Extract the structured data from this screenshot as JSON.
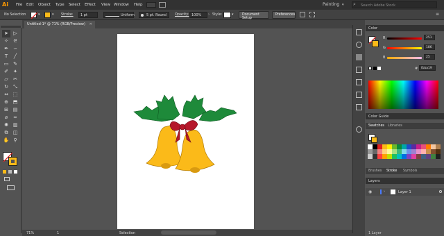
{
  "app": {
    "logo": "Ai",
    "workspace": "Painting",
    "search_placeholder": "Search Adobe Stock"
  },
  "menu": [
    "File",
    "Edit",
    "Object",
    "Type",
    "Select",
    "Effect",
    "View",
    "Window",
    "Help"
  ],
  "control": {
    "selection": "No Selection",
    "stroke_label": "Stroke:",
    "stroke_weight": "1 pt",
    "profile": "Uniform",
    "brush": "5 pt. Round",
    "opacity_label": "Opacity:",
    "opacity": "100%",
    "style_label": "Style:",
    "doc_setup": "Document Setup",
    "preferences": "Preferences"
  },
  "document": {
    "tab": "Untitled-1* @ 71% (RGB/Preview)"
  },
  "status": {
    "zoom": "71%",
    "page": "1",
    "mode": "Selection"
  },
  "color_panel": {
    "title": "Color",
    "r": "251",
    "g": "186",
    "b": "25",
    "hex": "fbba19",
    "colors": {
      "r": "#fbba19"
    }
  },
  "color_guide": {
    "title": "Color Guide"
  },
  "swatches": {
    "tabs": [
      "Swatches",
      "Libraries"
    ]
  },
  "stroke_panel": {
    "tabs": [
      "Brushes",
      "Stroke",
      "Symbols"
    ]
  },
  "layers": {
    "title": "Layers",
    "items": [
      {
        "name": "Layer 1"
      }
    ],
    "count": "1 Layer"
  },
  "tools": [
    "selection",
    "direct-select",
    "magic-wand",
    "lasso",
    "pen",
    "curvature",
    "type",
    "line",
    "rectangle",
    "paintbrush",
    "pencil",
    "shaper",
    "eraser",
    "scissors",
    "rotate",
    "scale",
    "width",
    "free-transform",
    "shape-builder",
    "perspective",
    "mesh",
    "gradient",
    "eyedropper",
    "blend",
    "symbol-sprayer",
    "graph",
    "artboard",
    "slice",
    "hand",
    "zoom"
  ]
}
